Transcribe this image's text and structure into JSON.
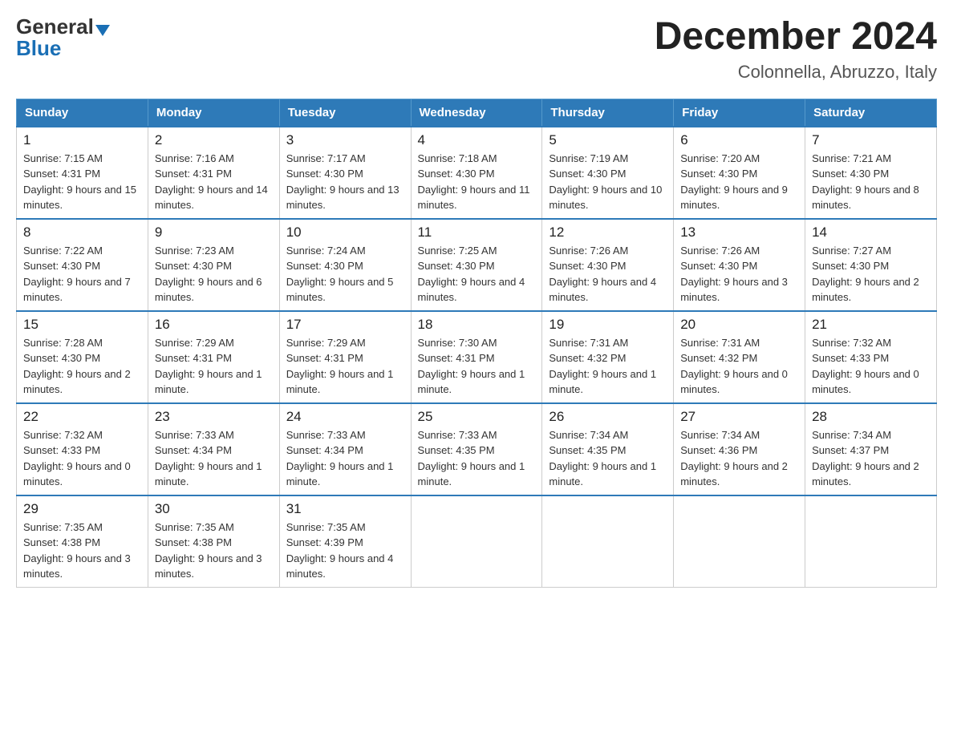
{
  "header": {
    "logo_general": "General",
    "logo_blue": "Blue",
    "title": "December 2024",
    "location": "Colonnella, Abruzzo, Italy"
  },
  "weekdays": [
    "Sunday",
    "Monday",
    "Tuesday",
    "Wednesday",
    "Thursday",
    "Friday",
    "Saturday"
  ],
  "weeks": [
    [
      {
        "day": "1",
        "sunrise": "7:15 AM",
        "sunset": "4:31 PM",
        "daylight": "9 hours and 15 minutes."
      },
      {
        "day": "2",
        "sunrise": "7:16 AM",
        "sunset": "4:31 PM",
        "daylight": "9 hours and 14 minutes."
      },
      {
        "day": "3",
        "sunrise": "7:17 AM",
        "sunset": "4:30 PM",
        "daylight": "9 hours and 13 minutes."
      },
      {
        "day": "4",
        "sunrise": "7:18 AM",
        "sunset": "4:30 PM",
        "daylight": "9 hours and 11 minutes."
      },
      {
        "day": "5",
        "sunrise": "7:19 AM",
        "sunset": "4:30 PM",
        "daylight": "9 hours and 10 minutes."
      },
      {
        "day": "6",
        "sunrise": "7:20 AM",
        "sunset": "4:30 PM",
        "daylight": "9 hours and 9 minutes."
      },
      {
        "day": "7",
        "sunrise": "7:21 AM",
        "sunset": "4:30 PM",
        "daylight": "9 hours and 8 minutes."
      }
    ],
    [
      {
        "day": "8",
        "sunrise": "7:22 AM",
        "sunset": "4:30 PM",
        "daylight": "9 hours and 7 minutes."
      },
      {
        "day": "9",
        "sunrise": "7:23 AM",
        "sunset": "4:30 PM",
        "daylight": "9 hours and 6 minutes."
      },
      {
        "day": "10",
        "sunrise": "7:24 AM",
        "sunset": "4:30 PM",
        "daylight": "9 hours and 5 minutes."
      },
      {
        "day": "11",
        "sunrise": "7:25 AM",
        "sunset": "4:30 PM",
        "daylight": "9 hours and 4 minutes."
      },
      {
        "day": "12",
        "sunrise": "7:26 AM",
        "sunset": "4:30 PM",
        "daylight": "9 hours and 4 minutes."
      },
      {
        "day": "13",
        "sunrise": "7:26 AM",
        "sunset": "4:30 PM",
        "daylight": "9 hours and 3 minutes."
      },
      {
        "day": "14",
        "sunrise": "7:27 AM",
        "sunset": "4:30 PM",
        "daylight": "9 hours and 2 minutes."
      }
    ],
    [
      {
        "day": "15",
        "sunrise": "7:28 AM",
        "sunset": "4:30 PM",
        "daylight": "9 hours and 2 minutes."
      },
      {
        "day": "16",
        "sunrise": "7:29 AM",
        "sunset": "4:31 PM",
        "daylight": "9 hours and 1 minute."
      },
      {
        "day": "17",
        "sunrise": "7:29 AM",
        "sunset": "4:31 PM",
        "daylight": "9 hours and 1 minute."
      },
      {
        "day": "18",
        "sunrise": "7:30 AM",
        "sunset": "4:31 PM",
        "daylight": "9 hours and 1 minute."
      },
      {
        "day": "19",
        "sunrise": "7:31 AM",
        "sunset": "4:32 PM",
        "daylight": "9 hours and 1 minute."
      },
      {
        "day": "20",
        "sunrise": "7:31 AM",
        "sunset": "4:32 PM",
        "daylight": "9 hours and 0 minutes."
      },
      {
        "day": "21",
        "sunrise": "7:32 AM",
        "sunset": "4:33 PM",
        "daylight": "9 hours and 0 minutes."
      }
    ],
    [
      {
        "day": "22",
        "sunrise": "7:32 AM",
        "sunset": "4:33 PM",
        "daylight": "9 hours and 0 minutes."
      },
      {
        "day": "23",
        "sunrise": "7:33 AM",
        "sunset": "4:34 PM",
        "daylight": "9 hours and 1 minute."
      },
      {
        "day": "24",
        "sunrise": "7:33 AM",
        "sunset": "4:34 PM",
        "daylight": "9 hours and 1 minute."
      },
      {
        "day": "25",
        "sunrise": "7:33 AM",
        "sunset": "4:35 PM",
        "daylight": "9 hours and 1 minute."
      },
      {
        "day": "26",
        "sunrise": "7:34 AM",
        "sunset": "4:35 PM",
        "daylight": "9 hours and 1 minute."
      },
      {
        "day": "27",
        "sunrise": "7:34 AM",
        "sunset": "4:36 PM",
        "daylight": "9 hours and 2 minutes."
      },
      {
        "day": "28",
        "sunrise": "7:34 AM",
        "sunset": "4:37 PM",
        "daylight": "9 hours and 2 minutes."
      }
    ],
    [
      {
        "day": "29",
        "sunrise": "7:35 AM",
        "sunset": "4:38 PM",
        "daylight": "9 hours and 3 minutes."
      },
      {
        "day": "30",
        "sunrise": "7:35 AM",
        "sunset": "4:38 PM",
        "daylight": "9 hours and 3 minutes."
      },
      {
        "day": "31",
        "sunrise": "7:35 AM",
        "sunset": "4:39 PM",
        "daylight": "9 hours and 4 minutes."
      },
      null,
      null,
      null,
      null
    ]
  ]
}
